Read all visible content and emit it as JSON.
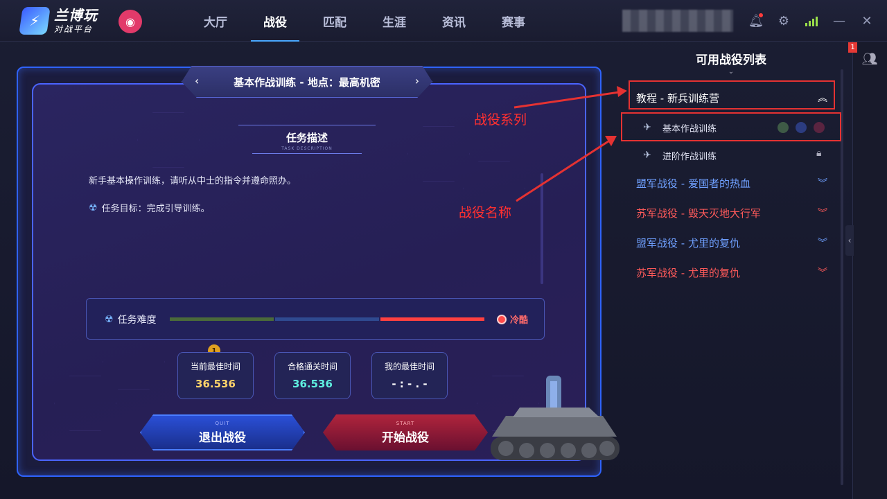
{
  "app": {
    "logo_title": "兰博玩",
    "logo_sub": "对战平台"
  },
  "nav": [
    {
      "label": "大厅",
      "active": false
    },
    {
      "label": "战役",
      "active": true
    },
    {
      "label": "匹配",
      "active": false
    },
    {
      "label": "生涯",
      "active": false
    },
    {
      "label": "资讯",
      "active": false
    },
    {
      "label": "赛事",
      "active": false
    }
  ],
  "friends": {
    "badge": "1"
  },
  "mission_panel": {
    "title": "基本作战训练 - 地点：最高机密",
    "desc_heading": "任务描述",
    "desc_heading_en": "TASK DESCRIPTION",
    "description": "新手基本操作训练，请听从中士的指令并遵命照办。",
    "goal": "任务目标：完成引导训练。",
    "difficulty_label": "任务难度",
    "difficulty_value": "冷酷",
    "stats": [
      {
        "label": "当前最佳时间",
        "value": "36.536",
        "color": "#ffd36a"
      },
      {
        "label": "合格通关时间",
        "value": "36.536",
        "color": "#5ff0e0"
      },
      {
        "label": "我的最佳时间",
        "value": "- : - . -",
        "color": "#ffffff"
      }
    ],
    "quit_en": "QUIT",
    "quit_label": "退出战役",
    "start_en": "START",
    "start_label": "开始战役"
  },
  "campaign_list": {
    "title": "可用战役列表",
    "series": [
      {
        "label": "教程 - 新兵训练营",
        "color": "#ffffff",
        "expanded": true
      },
      {
        "label": "盟军战役 - 爱国者的热血",
        "color": "#6fa0ff"
      },
      {
        "label": "苏军战役 - 毁天灭地大行军",
        "color": "#ff5a5a"
      },
      {
        "label": "盟军战役 - 尤里的复仇",
        "color": "#6fa0ff"
      },
      {
        "label": "苏军战役 - 尤里的复仇",
        "color": "#ff5a5a"
      }
    ],
    "missions": [
      {
        "label": "基本作战训练",
        "locked": false
      },
      {
        "label": "进阶作战训练",
        "locked": true
      }
    ]
  },
  "annotations": {
    "series": "战役系列",
    "name": "战役名称"
  }
}
